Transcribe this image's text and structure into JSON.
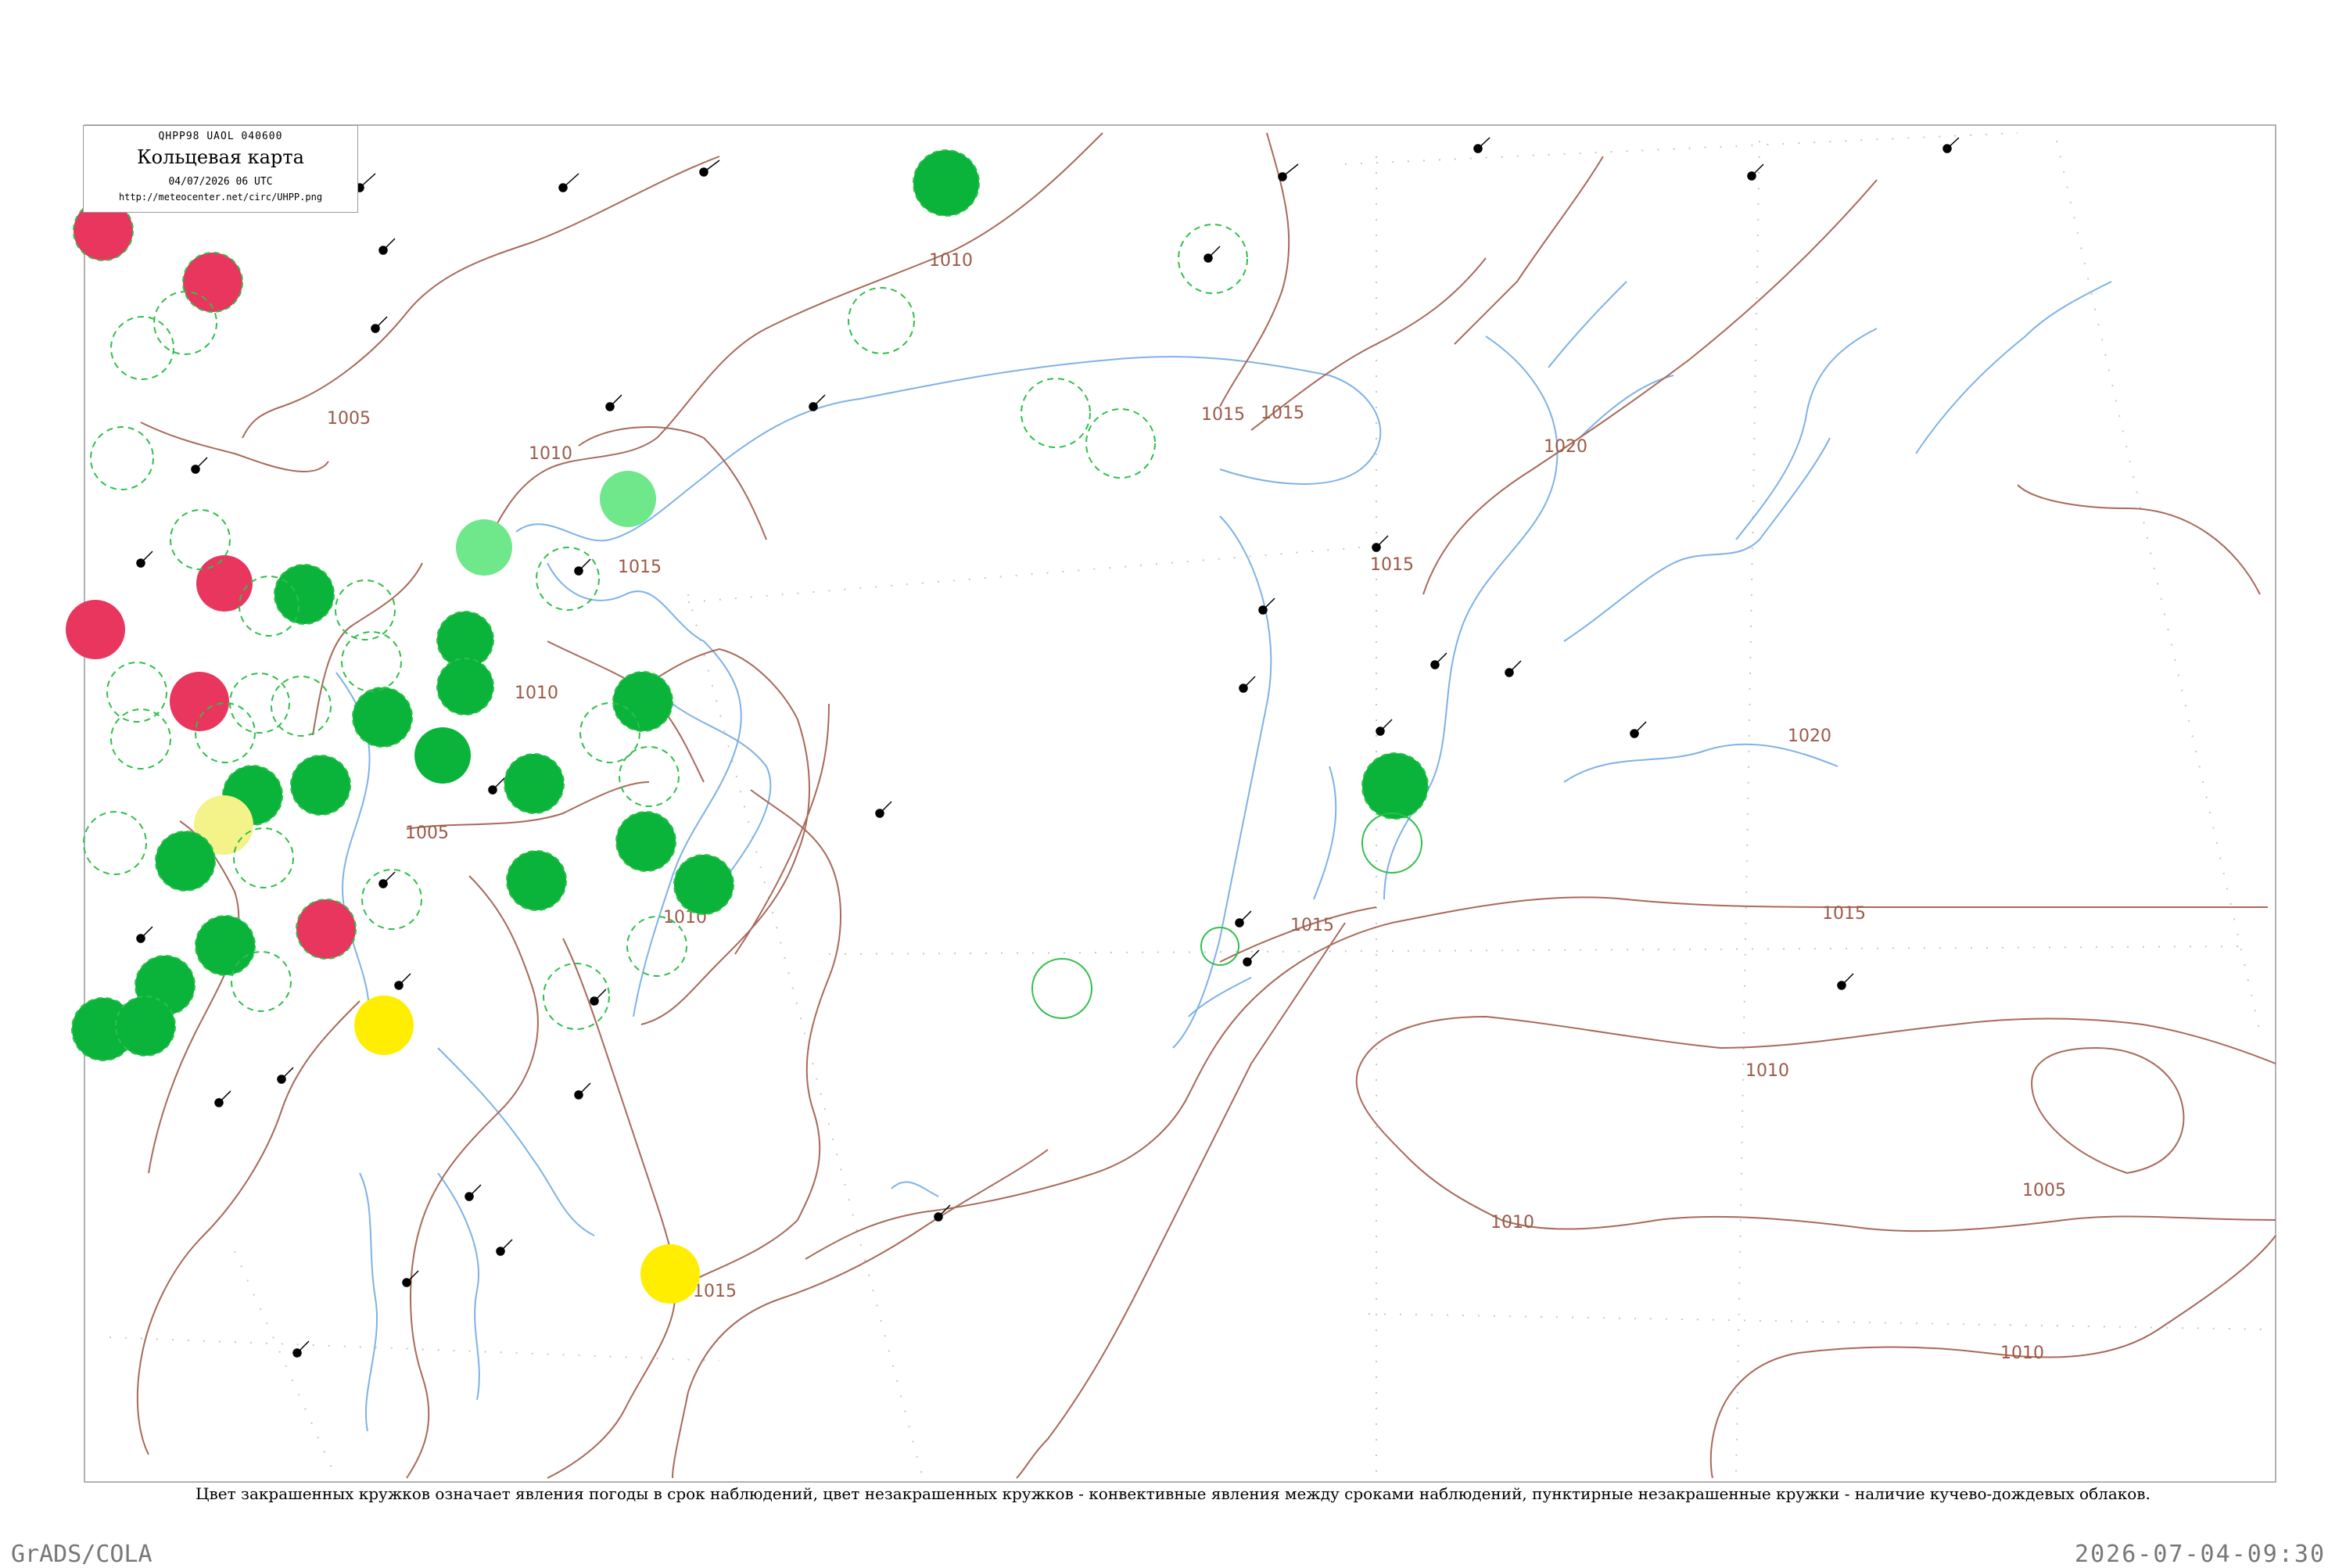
{
  "header": {
    "code": "QHPP98  UAOL  040600",
    "title": "Кольцевая карта",
    "datetime": "04/07/2026 06 UTC",
    "url": "http://meteocenter.net/circ/UHPP.png"
  },
  "legend_caption": "Цвет закрашенных кружков означает явления погоды в срок наблюдений, цвет незакрашенных кружков - конвективные явления между сроками наблюдений, пунктирные незакрашенные кружки - наличие кучево-дождевых облаков.",
  "footer": {
    "left": "GrADS/COLA",
    "right": "2026-07-04-09:30"
  },
  "isobar_labels": [
    "1010",
    "1005",
    "1010",
    "1015",
    "1010",
    "1015",
    "1015",
    "1020",
    "1015",
    "1020",
    "1015",
    "1010",
    "1005",
    "1010",
    "1010",
    "1015",
    "1005",
    "1015",
    "1010"
  ],
  "colors": {
    "isobar": "#a86a5a",
    "river": "#6aa3e0",
    "grid": "#bbbbbb",
    "frame": "#999999",
    "station_green": "#0ab33a",
    "station_light_green": "#6ee88a",
    "station_red": "#e8365e",
    "station_yellow": "#ffee00",
    "station_pale_yellow": "#f3f38a",
    "dashed_ring": "#2fbf4a"
  }
}
